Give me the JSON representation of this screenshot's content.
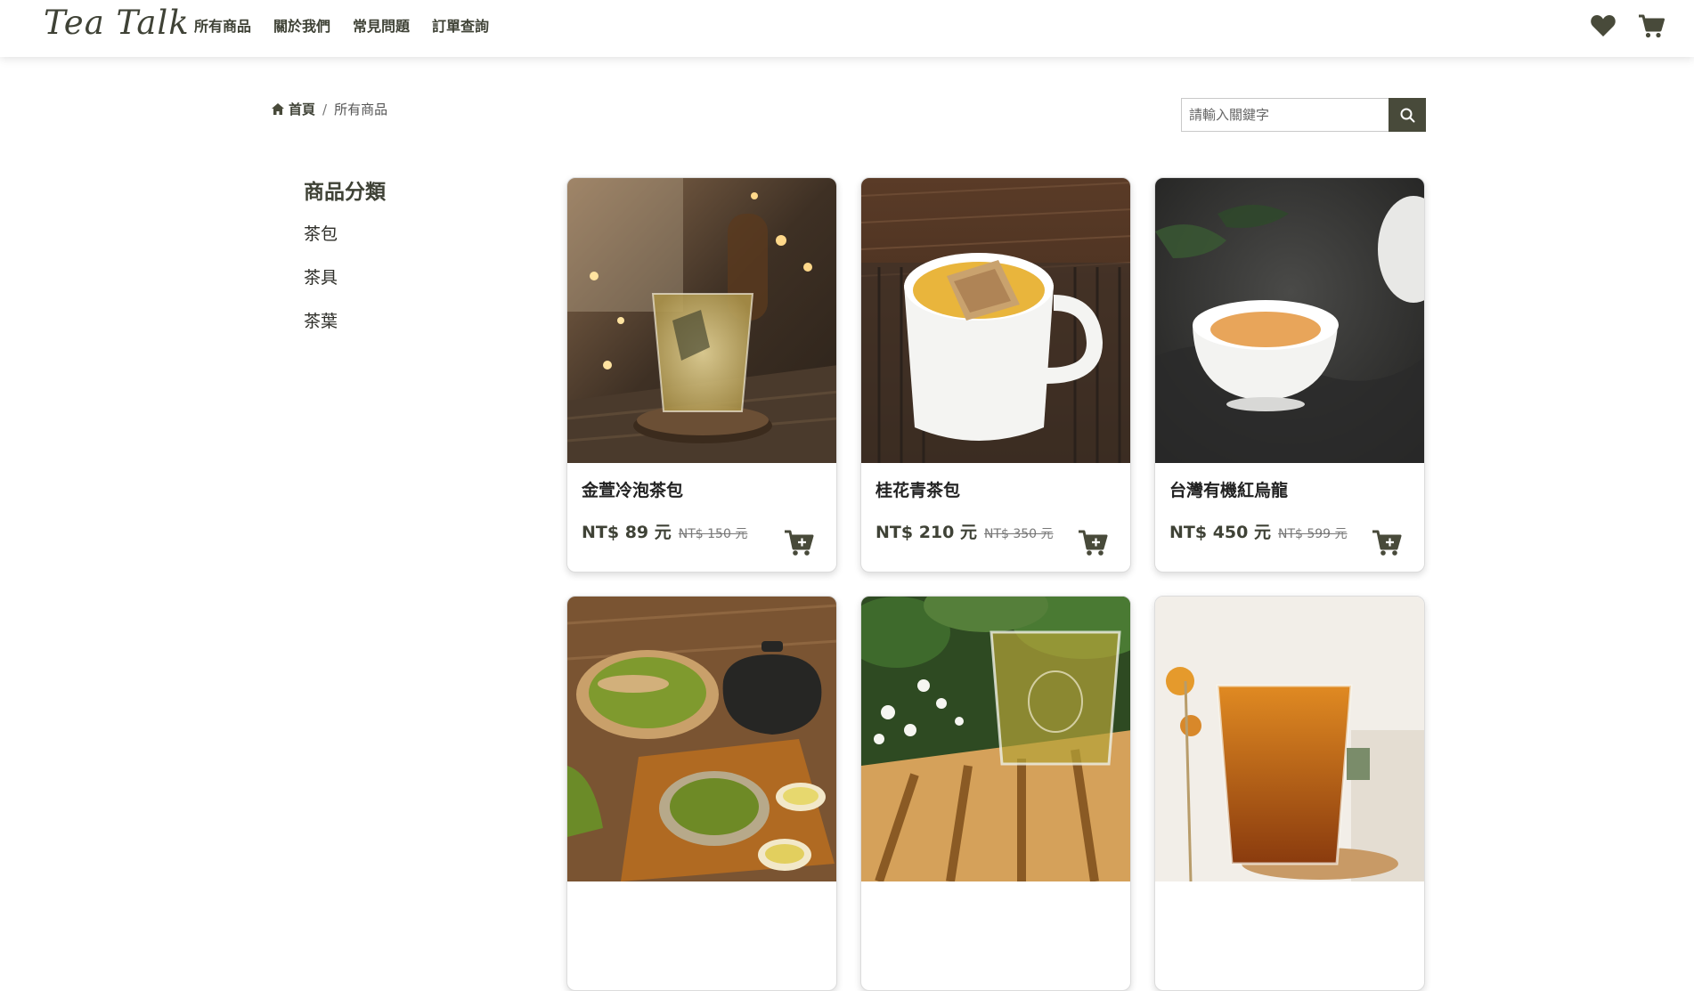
{
  "nav": {
    "brand": "Tea Talk",
    "links": [
      "所有商品",
      "關於我們",
      "常見問題",
      "訂單查詢"
    ],
    "wishlist_icon": "heart-icon",
    "cart_icon": "cart-icon"
  },
  "breadcrumb": {
    "home": "首頁",
    "separator": "/",
    "current": "所有商品"
  },
  "search": {
    "placeholder": "請輸入關鍵字",
    "icon": "search-icon"
  },
  "sidebar": {
    "title": "商品分類",
    "items": [
      "茶包",
      "茶具",
      "茶葉"
    ]
  },
  "products": [
    {
      "name": "金萱冷泡茶包",
      "price": "NT$ 89 元",
      "original_price": "NT$ 150 元"
    },
    {
      "name": "桂花青茶包",
      "price": "NT$ 210 元",
      "original_price": "NT$ 350 元"
    },
    {
      "name": "台灣有機紅烏龍",
      "price": "NT$ 450 元",
      "original_price": "NT$ 599 元"
    },
    {
      "name": "",
      "price": "",
      "original_price": ""
    },
    {
      "name": "",
      "price": "",
      "original_price": ""
    },
    {
      "name": "",
      "price": "",
      "original_price": ""
    }
  ],
  "colors": {
    "primary": "#484a3a",
    "text": "#3f4236"
  }
}
